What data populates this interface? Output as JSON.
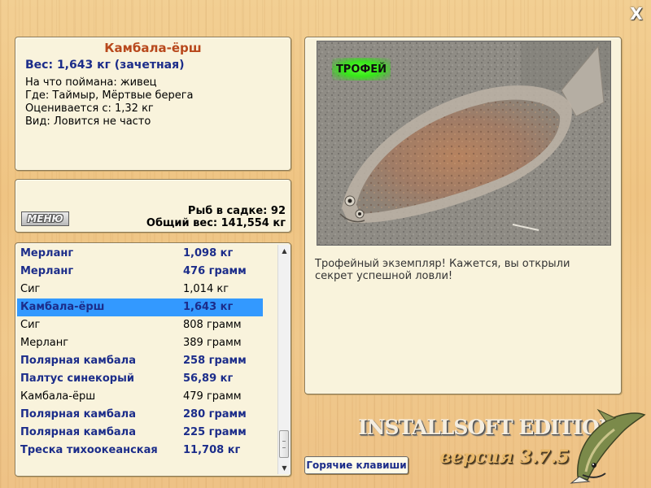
{
  "close_symbol": "X",
  "info": {
    "title": "Камбала-ёрш",
    "weight": "Вес: 1,643 кг (зачетная)",
    "lines": [
      "На что поймана: живец",
      "Где: Таймыр, Мёртвые берега",
      "Оценивается с: 1,32 кг",
      "Вид: Ловится не часто"
    ]
  },
  "stats": {
    "menu_label": "МЕНЮ",
    "fish_count": "Рыб в садке: 92",
    "total_weight": "Общий вес: 141,554 кг"
  },
  "catch_list": [
    {
      "name": "Мерланг",
      "weight": "1,098 кг",
      "bold": true,
      "selected": false
    },
    {
      "name": "Мерланг",
      "weight": "476 грамм",
      "bold": true,
      "selected": false
    },
    {
      "name": "Сиг",
      "weight": "1,014 кг",
      "bold": false,
      "selected": false
    },
    {
      "name": "Камбала-ёрш",
      "weight": "1,643 кг",
      "bold": true,
      "selected": true
    },
    {
      "name": "Сиг",
      "weight": "808 грамм",
      "bold": false,
      "selected": false
    },
    {
      "name": "Мерланг",
      "weight": "389 грамм",
      "bold": false,
      "selected": false
    },
    {
      "name": "Полярная камбала",
      "weight": "258 грамм",
      "bold": true,
      "selected": false
    },
    {
      "name": "Палтус синекорый",
      "weight": "56,89 кг",
      "bold": true,
      "selected": false
    },
    {
      "name": "Камбала-ёрш",
      "weight": "479 грамм",
      "bold": false,
      "selected": false
    },
    {
      "name": "Полярная камбала",
      "weight": "280 грамм",
      "bold": true,
      "selected": false
    },
    {
      "name": "Полярная камбала",
      "weight": "225 грамм",
      "bold": true,
      "selected": false
    },
    {
      "name": "Треска тихоокеанская",
      "weight": "11,708 кг",
      "bold": true,
      "selected": false
    }
  ],
  "scrollbar": {
    "up_arrow": "▲",
    "down_arrow": "▼"
  },
  "photo": {
    "trophy_label": "ТРОФЕЙ"
  },
  "description": "Трофейный экземпляр! Кажется, вы открыли секрет успешной ловли!",
  "hotkeys_label": "Горячие клавиши",
  "brand": {
    "edition": "INSTALLSOFT EDITION",
    "version": "версия 3.7.5"
  },
  "colors": {
    "accent_title": "#b8481c",
    "list_bold_text": "#1c2d8a",
    "selection": "#3399ff",
    "panel_bg": "#f9f3dc"
  }
}
